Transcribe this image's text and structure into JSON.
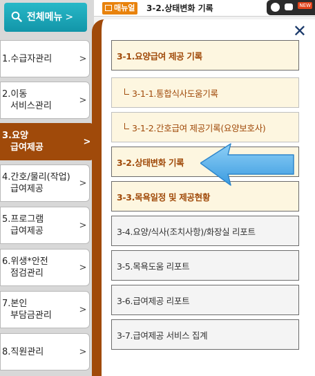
{
  "topbar": {
    "manual_label": "매뉴얼",
    "breadcrumb": "3-2.상태변화 기록",
    "widget_new": "NEW"
  },
  "sidebar": {
    "menu_button": "전체메뉴",
    "menu_arrow": ">",
    "items": [
      {
        "line1": "1.수급자관리",
        "line2": "",
        "active": false
      },
      {
        "line1": "2.이동",
        "line2": "서비스관리",
        "active": false
      },
      {
        "line1": "3.요양",
        "line2": "급여제공",
        "active": true
      },
      {
        "line1": "4.간호/물리(작업)",
        "line2": "급여제공",
        "active": false
      },
      {
        "line1": "5.프로그램",
        "line2": "급여제공",
        "active": false
      },
      {
        "line1": "6.위생*안전",
        "line2": "점검관리",
        "active": false
      },
      {
        "line1": "7.본인",
        "line2": "부담금관리",
        "active": false
      },
      {
        "line1": "8.직원관리",
        "line2": "",
        "active": false
      }
    ],
    "chevron": ">"
  },
  "panel": {
    "close_glyph": "✕",
    "items": [
      {
        "label": "3-1.요양급여 제공 기록",
        "style": "orange"
      },
      {
        "label": "3-1-1.통합식사도움기록",
        "style": "sub"
      },
      {
        "label": "3-1-2.간호급여 제공기록(요양보호사)",
        "style": "sub"
      },
      {
        "label": "3-2.상태변화 기록",
        "style": "orange"
      },
      {
        "label": "3-3.목욕일정 및 제공현황",
        "style": "orange"
      },
      {
        "label": "3-4.요양/식사(조치사항)/화장실 리포트",
        "style": "plain"
      },
      {
        "label": "3-5.목욕도움 리포트",
        "style": "plain"
      },
      {
        "label": "3-6.급여제공 리포트",
        "style": "plain"
      },
      {
        "label": "3-7.급여제공 서비스 집계",
        "style": "plain"
      }
    ]
  },
  "colors": {
    "accent_brown": "#a04a0a",
    "menu_teal": "#1ba7b8",
    "close_navy": "#1b3a6b",
    "arrow_blue": "#4aa8e8"
  }
}
